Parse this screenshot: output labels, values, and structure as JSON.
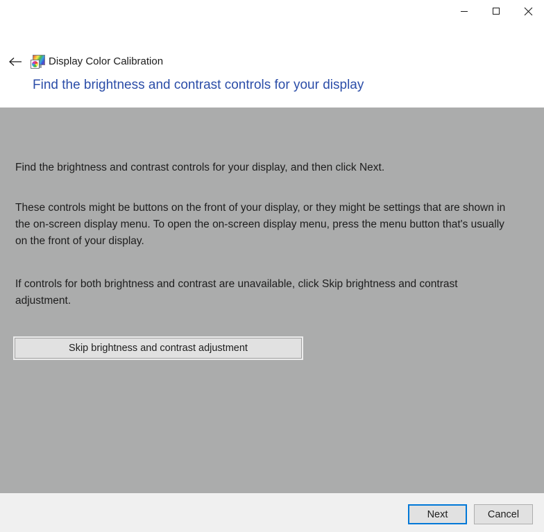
{
  "window": {
    "app_title": "Display Color Calibration",
    "app_icon": "display-color-calibration-icon",
    "back_icon": "back-arrow-icon",
    "controls": {
      "minimize": "minimize-icon",
      "maximize": "maximize-icon",
      "close": "close-icon"
    }
  },
  "page": {
    "heading": "Find the brightness and contrast controls for your display",
    "paragraphs": [
      "Find the brightness and contrast controls for your display, and then click Next.",
      "These controls might be buttons on the front of your display, or they might be settings that are shown in the on-screen display menu. To open the on-screen display menu, press the menu button that's usually on the front of your display.",
      "If controls for both brightness and contrast are unavailable, click Skip brightness and contrast adjustment."
    ],
    "skip_button_label": "Skip brightness and contrast adjustment"
  },
  "footer": {
    "next_label": "Next",
    "cancel_label": "Cancel"
  },
  "colors": {
    "heading_blue": "#2b4da8",
    "content_gray": "#abacac",
    "footer_gray": "#f0f0f0",
    "accent_blue": "#0078d7",
    "button_face": "#e1e1e1"
  }
}
